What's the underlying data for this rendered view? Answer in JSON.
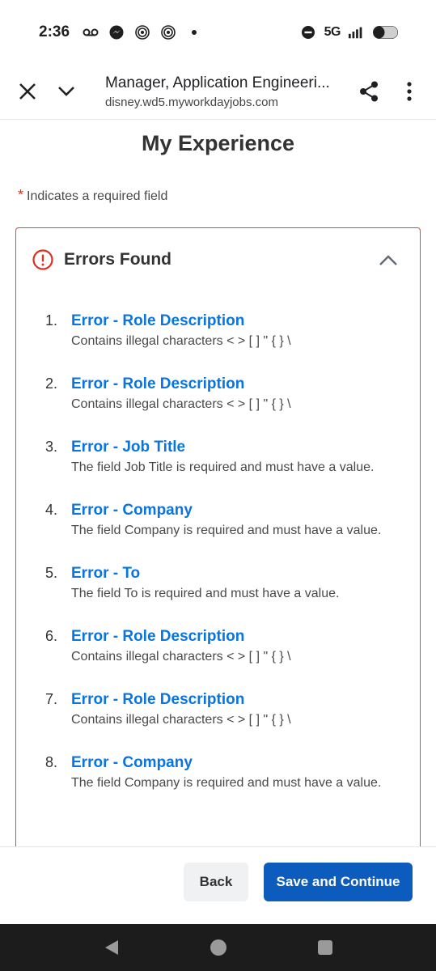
{
  "status_bar": {
    "time": "2:36",
    "network": "5G",
    "icons": [
      "voicemail-icon",
      "messenger-icon",
      "podcast-icon",
      "podcast-icon",
      "dot-icon",
      "do-not-disturb-icon",
      "signal-icon",
      "battery-icon"
    ]
  },
  "browser": {
    "page_title": "Manager, Application Engineeri...",
    "url": "disney.wd5.myworkdayjobs.com"
  },
  "page": {
    "heading": "My Experience",
    "required_star": "*",
    "required_note": "Indicates a required field"
  },
  "errors": {
    "title": "Errors Found",
    "items": [
      {
        "num": "1.",
        "title": "Error - Role Description",
        "desc": "Contains illegal characters < > [ ] \" { } \\"
      },
      {
        "num": "2.",
        "title": "Error - Role Description",
        "desc": "Contains illegal characters < > [ ] \" { } \\"
      },
      {
        "num": "3.",
        "title": "Error - Job Title",
        "desc": "The field Job Title is required and must have a value."
      },
      {
        "num": "4.",
        "title": "Error - Company",
        "desc": "The field Company is required and must have a value."
      },
      {
        "num": "5.",
        "title": "Error - To",
        "desc": "The field To is required and must have a value."
      },
      {
        "num": "6.",
        "title": "Error - Role Description",
        "desc": "Contains illegal characters < > [ ] \" { } \\"
      },
      {
        "num": "7.",
        "title": "Error - Role Description",
        "desc": "Contains illegal characters < > [ ] \" { } \\"
      },
      {
        "num": "8.",
        "title": "Error - Company",
        "desc": "The field Company is required and must have a value."
      }
    ]
  },
  "actions": {
    "back_label": "Back",
    "save_label": "Save and Continue"
  },
  "colors": {
    "error_red": "#de4a3d",
    "link_blue": "#0875e1",
    "primary_button": "#0b5cbd"
  }
}
